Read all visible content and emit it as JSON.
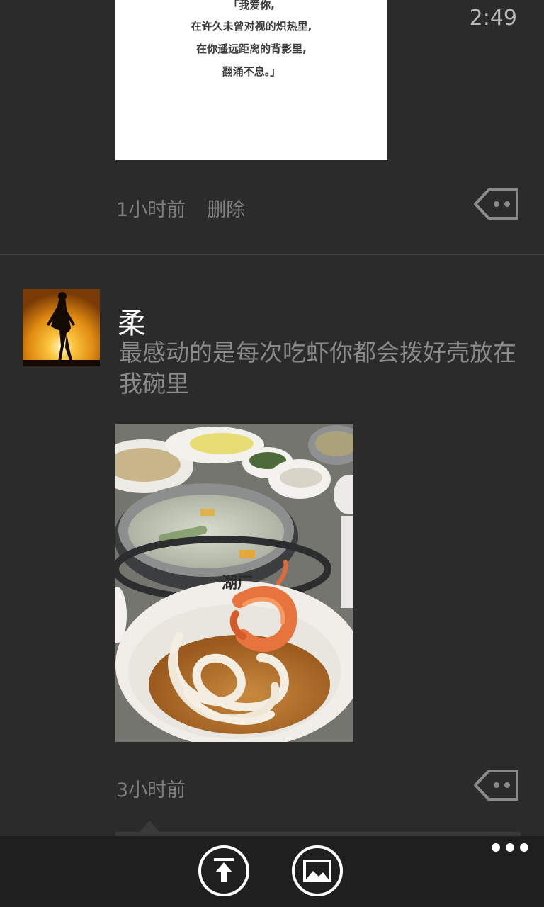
{
  "status_bar": {
    "time": "2:49"
  },
  "post1": {
    "image_text_lines": [
      "「我爱你,",
      "在许久未曾对视的炽热里,",
      "在你遥远距离的背影里,",
      "翻涌不息。」"
    ],
    "time_ago": "1小时前",
    "delete_label": "删除"
  },
  "post2": {
    "username": "柔",
    "text": "最感动的是每次吃虾你都会拨好壳放在我碗里",
    "time_ago": "3小时前"
  },
  "app_bar": {
    "buttons": [
      "upload-icon",
      "picture-icon",
      "more-icon"
    ]
  },
  "colors": {
    "background": "#2b2b2b",
    "appbar": "#1f1f1f",
    "meta_text": "#7e7e7e",
    "body_text": "#8a8a8a"
  }
}
